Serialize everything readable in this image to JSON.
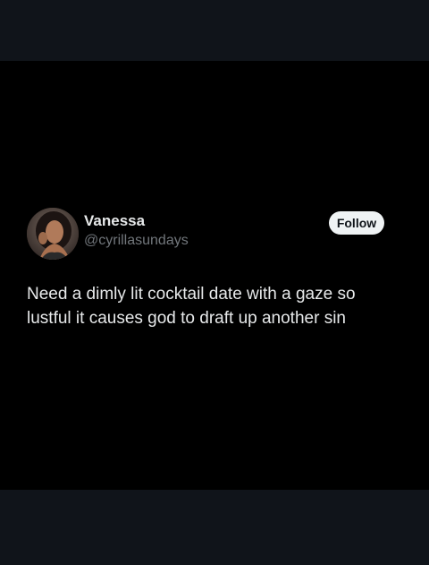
{
  "tweet": {
    "author": {
      "display_name": "Vanessa",
      "handle": "@cyrillasundays",
      "avatar_icon": "profile-photo"
    },
    "follow_label": "Follow",
    "text": "Need a dimly lit cocktail date with a gaze so lustful it causes god to draft up another sin"
  },
  "colors": {
    "background": "#000000",
    "letterbox": "#10141a",
    "primary_text": "#e7e9ea",
    "secondary_text": "#71767b",
    "follow_button_bg": "#eff3f4",
    "follow_button_text": "#0f1419"
  }
}
